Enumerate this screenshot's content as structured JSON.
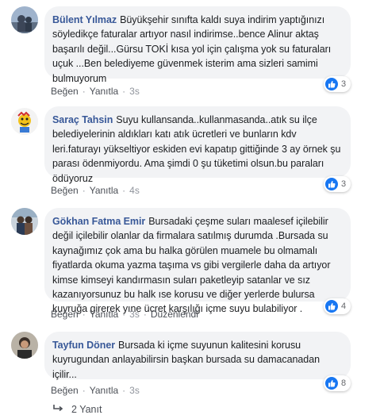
{
  "comments": [
    {
      "author": "Bülent Yılmaz",
      "text": "Büyükşehir sınıfta kaldı suya indirim yaptığınızı söyledikçe faturalar artıyor nasıl indirimse..bence Alinur aktaş başarılı değil...Gürsu TOKİ kısa yol için çalışma yok su faturaları uçuk ...Ben belediyeme güvenmek isterim ama sizleri samimi bulmuyorum",
      "reaction_count": "3",
      "like_label": "Beğen",
      "reply_label": "Yanıtla",
      "time": "3s"
    },
    {
      "author": "Saraç Tahsin",
      "text": "Suyu kullansanda..kullanmasanda..atık su ilçe belediyelerinin aldıkları katı atık ücretleri ve bunların kdv leri.faturayı yükseltiyor eskiden evi kapatıp gittiğinde 3 ay örnek şu parası ödenmiyordu. Ama şimdi 0 şu tüketimi olsun.bu paraları ödüyoruz",
      "reaction_count": "3",
      "like_label": "Beğen",
      "reply_label": "Yanıtla",
      "time": "4s"
    },
    {
      "author": "Gökhan Fatma Emir",
      "text": "Bursadaki çeşme suları maalesef içilebilir değil içilebilir olanlar da firmalara satılmış durumda .Bursada su kaynağımız çok ama bu halka görülen muamele bu olmamalı fiyatlarda okuma yazma taşıma vs gibi vergilerle daha da artıyor kimse kimseyi kandırmasın suları paketleyip satanlar ve sız kazanıyorsunuz bu halk ıse korusu ve diğer yerlerde bulursa kuyruğa girerek yıne ücret karşılığı içme suyu bulabiliyor .",
      "reaction_count": "4",
      "like_label": "Beğen",
      "reply_label": "Yanıtla",
      "time": "3s",
      "edited_label": "Düzenlendi"
    },
    {
      "author": "Tayfun Döner",
      "text": "Bursada ki içme suyunun kalitesini korusu kuyrugundan anlayabilirsin başkan bursada su damacanadan içilir...",
      "reaction_count": "8",
      "like_label": "Beğen",
      "reply_label": "Yanıtla",
      "time": "3s"
    }
  ],
  "replies_label": "2 Yanıt",
  "colors": {
    "author": "#385898",
    "bubble": "#f2f3f5",
    "like": "#1877f2"
  },
  "icons": [
    "thumbs-up-icon",
    "reply-arrow-icon"
  ]
}
